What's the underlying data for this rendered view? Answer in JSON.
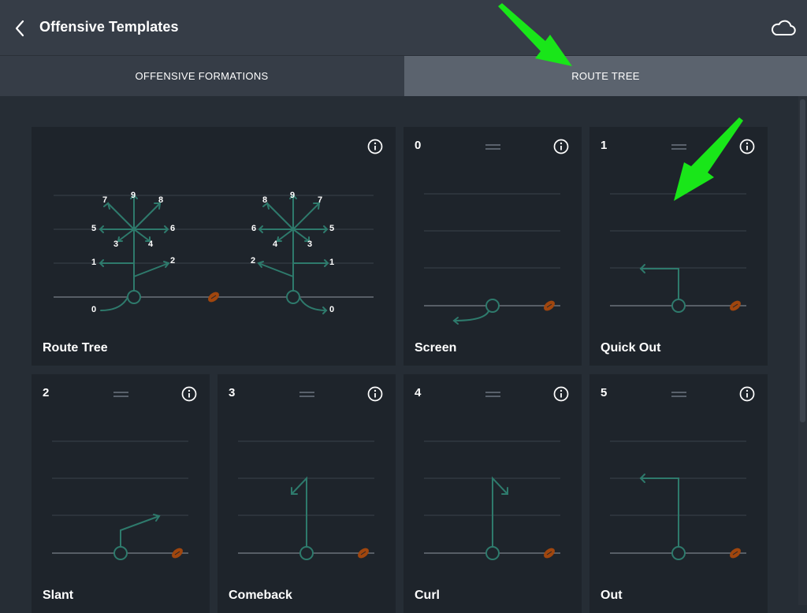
{
  "header": {
    "title": "Offensive Templates"
  },
  "tabs": [
    {
      "label": "OFFENSIVE FORMATIONS",
      "active": false
    },
    {
      "label": "ROUTE TREE",
      "active": true
    }
  ],
  "colors": {
    "accent_green": "#2e7a6c",
    "annotation_arrow": "#19e619",
    "football": "#a0460e",
    "active_tab": "#5b636e"
  },
  "cards": {
    "tree": {
      "name": "Route Tree",
      "left_labels": [
        "7",
        "9",
        "8",
        "5",
        "6",
        "3",
        "4",
        "1",
        "2",
        "0"
      ],
      "right_labels": [
        "8",
        "9",
        "7",
        "6",
        "5",
        "4",
        "3",
        "2",
        "1",
        "0"
      ]
    },
    "routes": [
      {
        "number": "0",
        "name": "Screen"
      },
      {
        "number": "1",
        "name": "Quick Out"
      },
      {
        "number": "2",
        "name": "Slant"
      },
      {
        "number": "3",
        "name": "Comeback"
      },
      {
        "number": "4",
        "name": "Curl"
      },
      {
        "number": "5",
        "name": "Out"
      }
    ]
  },
  "icons": {
    "back": "chevron-left-icon",
    "cloud": "cloud-icon",
    "info": "info-icon",
    "drag": "drag-handle-icon",
    "football": "football-icon",
    "annotation": "annotation-arrow-icon"
  }
}
